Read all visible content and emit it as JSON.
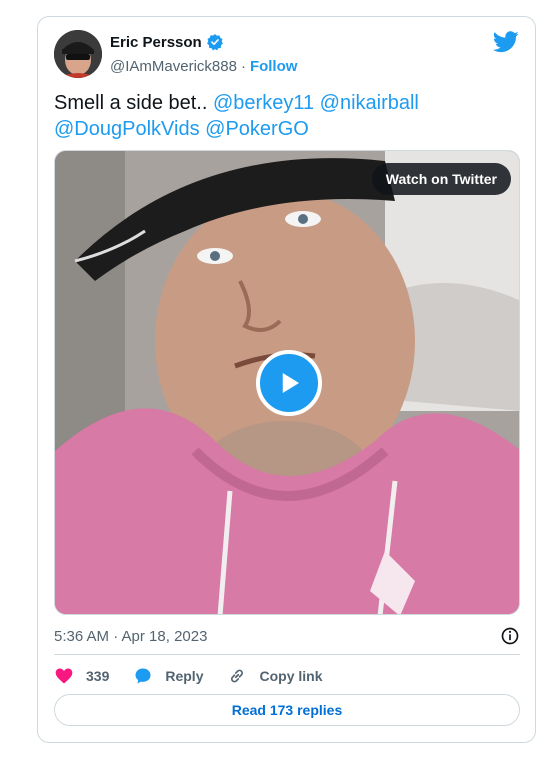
{
  "author": {
    "name": "Eric Persson",
    "handle": "@IAmMaverick888",
    "separator": "·",
    "follow_label": "Follow",
    "verified_icon": "verified-badge-icon"
  },
  "tweet": {
    "text_prefix": "Smell a side bet..",
    "mentions": [
      "@berkey11",
      "@nikairball",
      "@DougPolkVids",
      "@PokerGO"
    ]
  },
  "media": {
    "watch_label": "Watch on Twitter",
    "play_icon": "play-icon"
  },
  "meta": {
    "timestamp": "5:36 AM · Apr 18, 2023",
    "info_icon": "info-icon"
  },
  "actions": {
    "likes_count": "339",
    "reply_label": "Reply",
    "copy_link_label": "Copy link"
  },
  "footer": {
    "read_replies_label": "Read 173 replies"
  },
  "colors": {
    "accent": "#1d9bf0",
    "like": "#f91880",
    "text": "#0f1419",
    "muted": "#536471",
    "border": "#cfd9de"
  }
}
